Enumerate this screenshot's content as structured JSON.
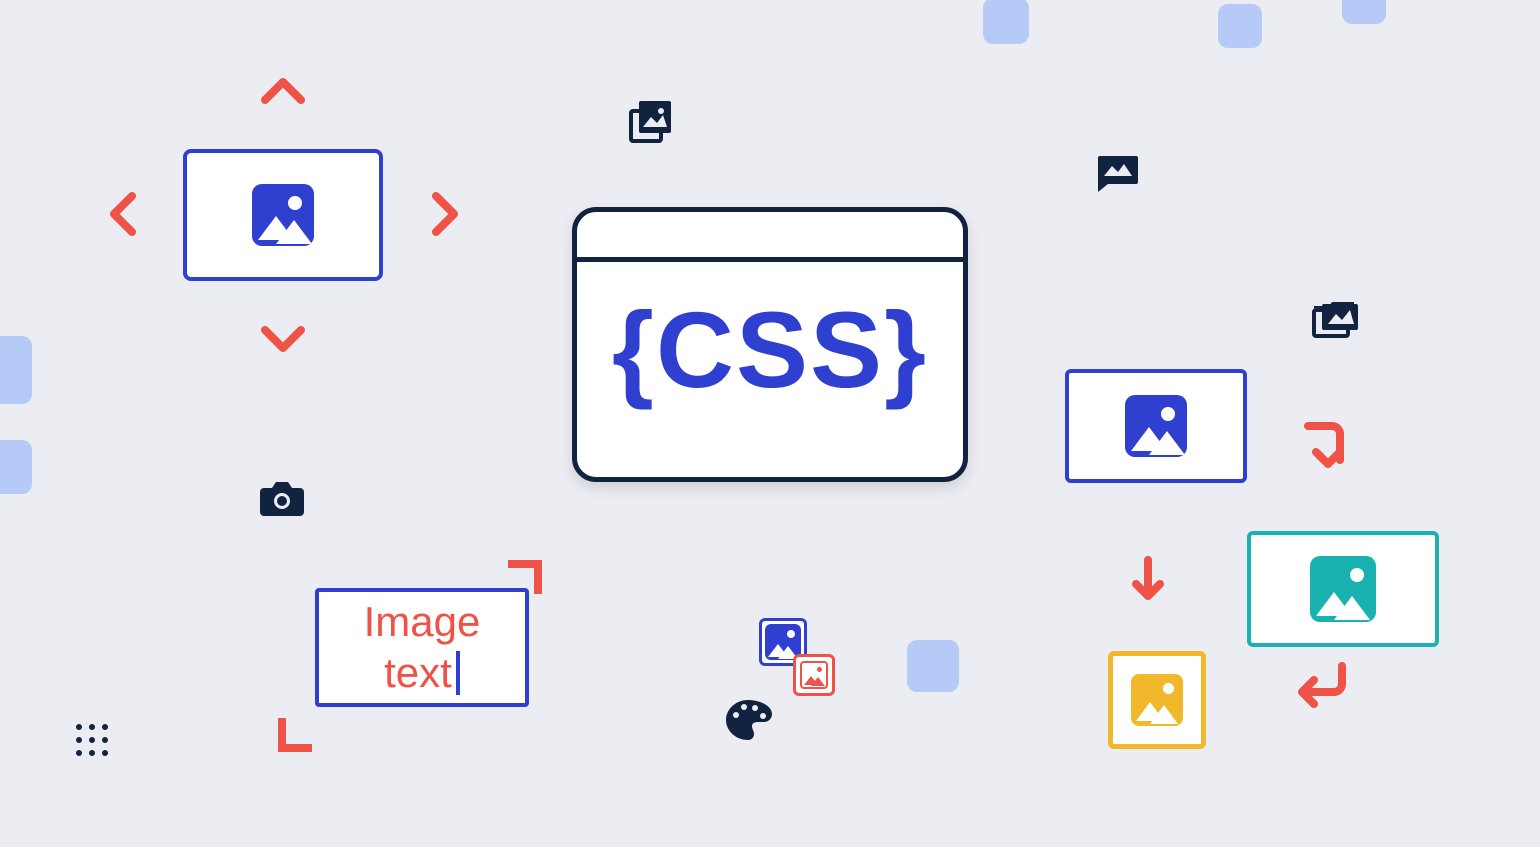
{
  "main_label": "CSS",
  "text_card": {
    "line1": "Image",
    "line2": "text"
  },
  "colors": {
    "blue": "#2f3fcf",
    "dark": "#12233f",
    "red": "#ef5246",
    "teal": "#19b2b0",
    "yellow": "#f0b82a",
    "light_blue": "#b6caf7",
    "bg": "#ecedf2"
  },
  "icons": {
    "image": "image-icon",
    "photo_stack": "photo-stack-icon",
    "camera": "camera-icon",
    "palette": "palette-icon",
    "mms": "mms-icon",
    "folder_image": "folder-image-icon",
    "grip": "grip-dots-icon",
    "chevron_up": "chevron-up-icon",
    "chevron_down": "chevron-down-icon",
    "chevron_left": "chevron-left-icon",
    "chevron_right": "chevron-right-icon",
    "arrow_turn_down": "arrow-turn-down-icon",
    "arrow_down": "arrow-down-icon",
    "arrow_return": "arrow-return-icon"
  }
}
